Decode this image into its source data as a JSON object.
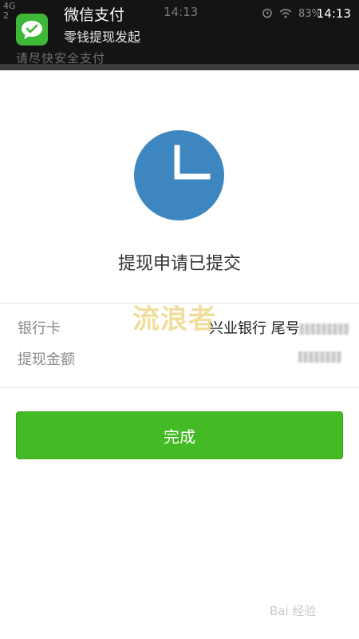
{
  "notification": {
    "app_title": "微信支付",
    "message": "零钱提现发起",
    "time": "14:13",
    "ghost_time": "14:13",
    "battery": "83%",
    "ghost_signal": "4G",
    "ghost_subtitle": "请尽快安全支付",
    "icon": "wechat-icon"
  },
  "main": {
    "status_icon": "clock-icon",
    "headline": "提现申请已提交",
    "rows": [
      {
        "label": "银行卡",
        "value": "兴业银行 尾号"
      },
      {
        "label": "提现金额",
        "value": ""
      }
    ],
    "done_label": "完成"
  },
  "watermark_text": "流浪者",
  "footer_watermark": "Bai 经验",
  "colors": {
    "accent_green": "#44bb24",
    "clock_blue": "#3d86c0",
    "wechat_green": "#3fb838"
  }
}
